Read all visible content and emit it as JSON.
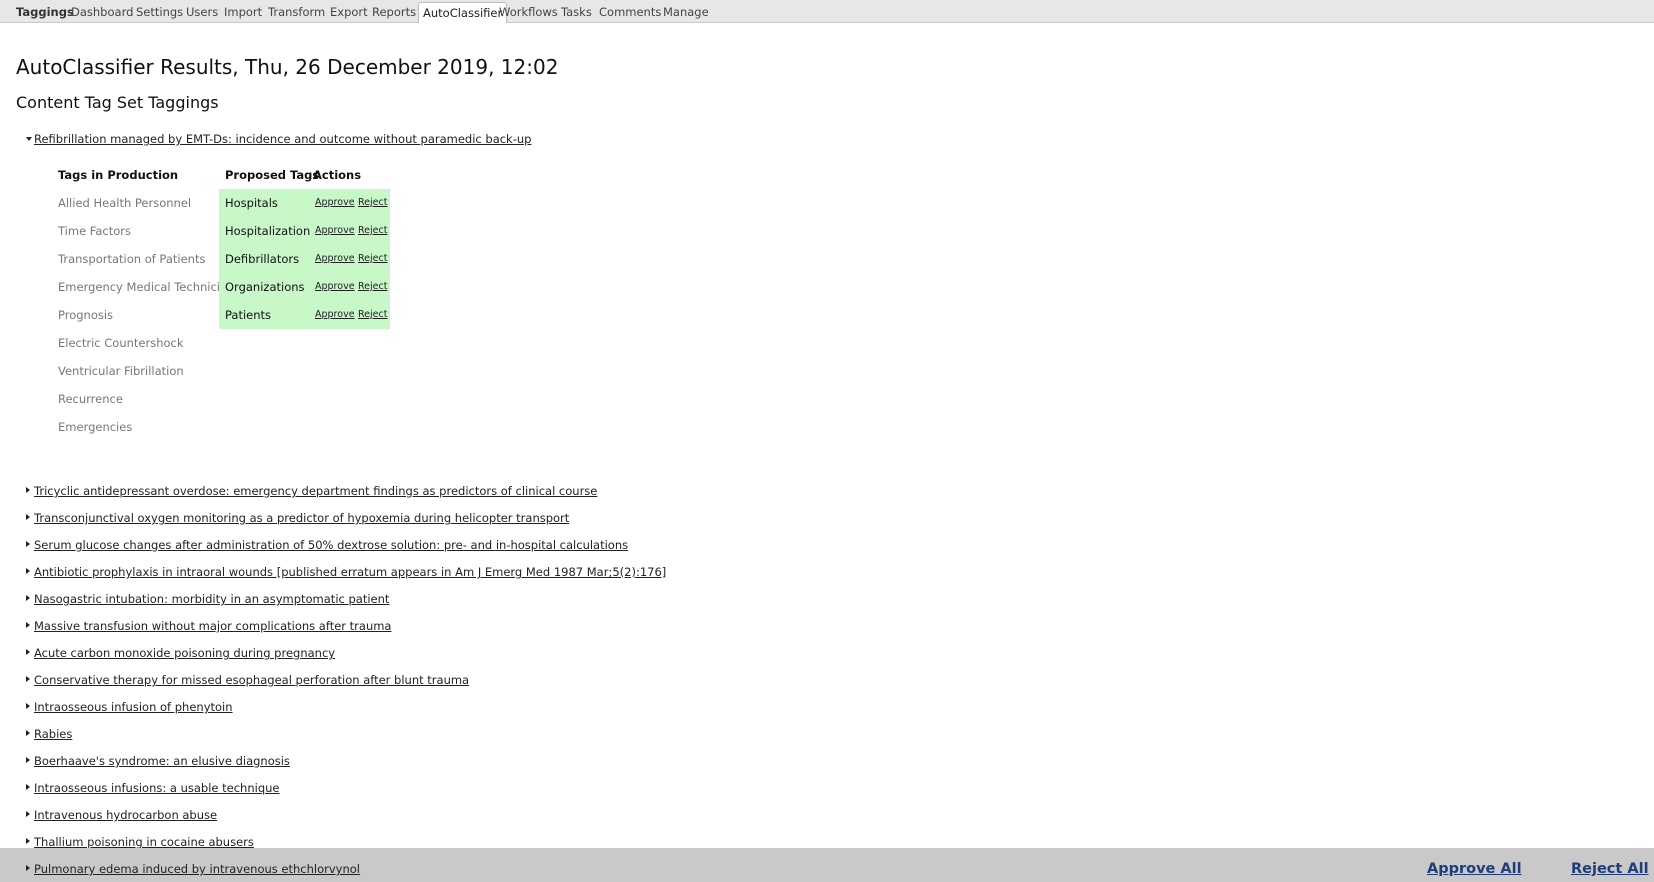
{
  "nav": {
    "brand": "Taggings",
    "tabs": [
      {
        "label": "Dashboard"
      },
      {
        "label": "Settings"
      },
      {
        "label": "Users"
      },
      {
        "label": "Import"
      },
      {
        "label": "Transform"
      },
      {
        "label": "Export"
      },
      {
        "label": "Reports"
      },
      {
        "label": "AutoClassifier",
        "active": true
      },
      {
        "label": "Workflows"
      },
      {
        "label": "Tasks"
      },
      {
        "label": "Comments"
      },
      {
        "label": "Manage"
      }
    ]
  },
  "page": {
    "title": "AutoClassifier Results, Thu, 26 December 2019, 12:02",
    "subtitle": "Content Tag Set Taggings"
  },
  "expanded": {
    "title": "Refibrillation managed by EMT-Ds: incidence and outcome without paramedic back-up",
    "headers": {
      "production": "Tags in Production",
      "proposed": "Proposed Tags",
      "actions": "Actions"
    },
    "production_tags": [
      "Allied Health Personnel",
      "Time Factors",
      "Transportation of Patients",
      "Emergency Medical Technicians",
      "Prognosis",
      "Electric Countershock",
      "Ventricular Fibrillation",
      "Recurrence",
      "Emergencies"
    ],
    "proposed_tags": [
      "Hospitals",
      "Hospitalization",
      "Defibrillators",
      "Organizations",
      "Patients"
    ],
    "approve_label": "Approve",
    "reject_label": "Reject"
  },
  "collapsed_items": [
    "Tricyclic antidepressant overdose: emergency department findings as predictors of clinical course",
    "Transconjunctival oxygen monitoring as a predictor of hypoxemia during helicopter transport",
    "Serum glucose changes after administration of 50% dextrose solution: pre- and in-hospital calculations",
    "Antibiotic prophylaxis in intraoral wounds [published erratum appears in Am J Emerg Med 1987 Mar;5(2):176]",
    "Nasogastric intubation: morbidity in an asymptomatic patient",
    "Massive transfusion without major complications after trauma",
    "Acute carbon monoxide poisoning during pregnancy",
    "Conservative therapy for missed esophageal perforation after blunt trauma",
    "Intraosseous infusion of phenytoin",
    "Rabies",
    "Boerhaave's syndrome: an elusive diagnosis",
    "Intraosseous infusions: a usable technique",
    "Intravenous hydrocarbon abuse",
    "Thallium poisoning in cocaine abusers",
    "Pulmonary edema induced by intravenous ethchlorvynol"
  ],
  "footer": {
    "approve_all": "Approve All",
    "reject_all": "Reject All"
  },
  "colors": {
    "proposed_bg": "#c8f7c8",
    "footer_bg": "#c9c9c9",
    "bulk_link": "#1f3d7a"
  }
}
